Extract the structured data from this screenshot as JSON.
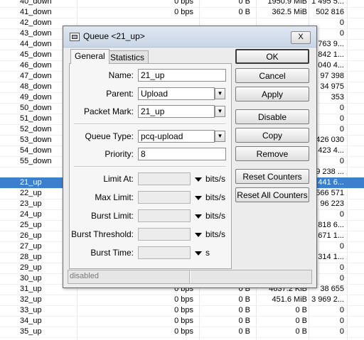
{
  "background_table": {
    "rows": [
      {
        "name": "40_down",
        "rate": "0 bps",
        "bytes": "0 B",
        "total": "1950.9 MiB",
        "packets": "1 495 5..."
      },
      {
        "name": "41_down",
        "rate": "0 bps",
        "bytes": "0 B",
        "total": "362.5 MiB",
        "packets": "502 816"
      },
      {
        "name": "42_down",
        "rate": "",
        "bytes": "",
        "total": "",
        "packets": "0"
      },
      {
        "name": "43_down",
        "rate": "",
        "bytes": "",
        "total": "",
        "packets": "0"
      },
      {
        "name": "44_down",
        "rate": "",
        "bytes": "",
        "total": "",
        "packets": "763 9..."
      },
      {
        "name": "45_down",
        "rate": "",
        "bytes": "",
        "total": "",
        "packets": "842 1..."
      },
      {
        "name": "46_down",
        "rate": "",
        "bytes": "",
        "total": "",
        "packets": "040 4..."
      },
      {
        "name": "47_down",
        "rate": "",
        "bytes": "",
        "total": "",
        "packets": "97 398"
      },
      {
        "name": "48_down",
        "rate": "",
        "bytes": "",
        "total": "",
        "packets": "34 975"
      },
      {
        "name": "49_down",
        "rate": "",
        "bytes": "",
        "total": "",
        "packets": "353"
      },
      {
        "name": "50_down",
        "rate": "",
        "bytes": "",
        "total": "",
        "packets": "0"
      },
      {
        "name": "51_down",
        "rate": "",
        "bytes": "",
        "total": "",
        "packets": "0"
      },
      {
        "name": "52_down",
        "rate": "",
        "bytes": "",
        "total": "",
        "packets": "0"
      },
      {
        "name": "53_down",
        "rate": "",
        "bytes": "",
        "total": "",
        "packets": "426 030"
      },
      {
        "name": "54_down",
        "rate": "",
        "bytes": "",
        "total": "",
        "packets": "423 4..."
      },
      {
        "name": "55_down",
        "rate": "",
        "bytes": "",
        "total": "",
        "packets": "0"
      },
      {
        "name": "",
        "rate": "",
        "bytes": "",
        "total": "",
        "packets": "9 238 ..."
      },
      {
        "name": "21_up",
        "rate": "",
        "bytes": "",
        "total": "",
        "packets": "441 6...",
        "selected": true
      },
      {
        "name": "22_up",
        "rate": "",
        "bytes": "",
        "total": "",
        "packets": "566 571"
      },
      {
        "name": "23_up",
        "rate": "",
        "bytes": "",
        "total": "",
        "packets": "96 223"
      },
      {
        "name": "24_up",
        "rate": "",
        "bytes": "",
        "total": "",
        "packets": "0"
      },
      {
        "name": "25_up",
        "rate": "",
        "bytes": "",
        "total": "",
        "packets": "818 6..."
      },
      {
        "name": "26_up",
        "rate": "",
        "bytes": "",
        "total": "",
        "packets": "671 1..."
      },
      {
        "name": "27_up",
        "rate": "",
        "bytes": "",
        "total": "",
        "packets": "0"
      },
      {
        "name": "28_up",
        "rate": "",
        "bytes": "",
        "total": "",
        "packets": "314 1..."
      },
      {
        "name": "29_up",
        "rate": "",
        "bytes": "",
        "total": "",
        "packets": "0"
      },
      {
        "name": "30_up",
        "rate": "",
        "bytes": "",
        "total": "",
        "packets": "0"
      },
      {
        "name": "31_up",
        "rate": "0 bps",
        "bytes": "0 B",
        "total": "4637.2 KiB",
        "packets": "38 655"
      },
      {
        "name": "32_up",
        "rate": "0 bps",
        "bytes": "0 B",
        "total": "451.6 MiB",
        "packets": "3 969 2..."
      },
      {
        "name": "33_up",
        "rate": "0 bps",
        "bytes": "0 B",
        "total": "0 B",
        "packets": "0"
      },
      {
        "name": "34_up",
        "rate": "0 bps",
        "bytes": "0 B",
        "total": "0 B",
        "packets": "0"
      },
      {
        "name": "35_up",
        "rate": "0 bps",
        "bytes": "0 B",
        "total": "0 B",
        "packets": "0"
      }
    ]
  },
  "dialog": {
    "title": "Queue <21_up>",
    "close_label": "X",
    "tabs": [
      "General",
      "Statistics"
    ],
    "fields": {
      "name_label": "Name:",
      "name_value": "21_up",
      "parent_label": "Parent:",
      "parent_value": "Upload",
      "packet_mark_label": "Packet Mark:",
      "packet_mark_value": "21_up",
      "queue_type_label": "Queue Type:",
      "queue_type_value": "pcq-upload",
      "priority_label": "Priority:",
      "priority_value": "8",
      "limit_at_label": "Limit At:",
      "max_limit_label": "Max Limit:",
      "burst_limit_label": "Burst Limit:",
      "burst_threshold_label": "Burst Threshold:",
      "burst_time_label": "Burst Time:",
      "unit_bits": "bits/s",
      "unit_s": "s"
    },
    "buttons": {
      "ok": "OK",
      "cancel": "Cancel",
      "apply": "Apply",
      "disable": "Disable",
      "copy": "Copy",
      "remove": "Remove",
      "reset_counters": "Reset Counters",
      "reset_all_counters": "Reset All Counters"
    },
    "status": "disabled"
  }
}
